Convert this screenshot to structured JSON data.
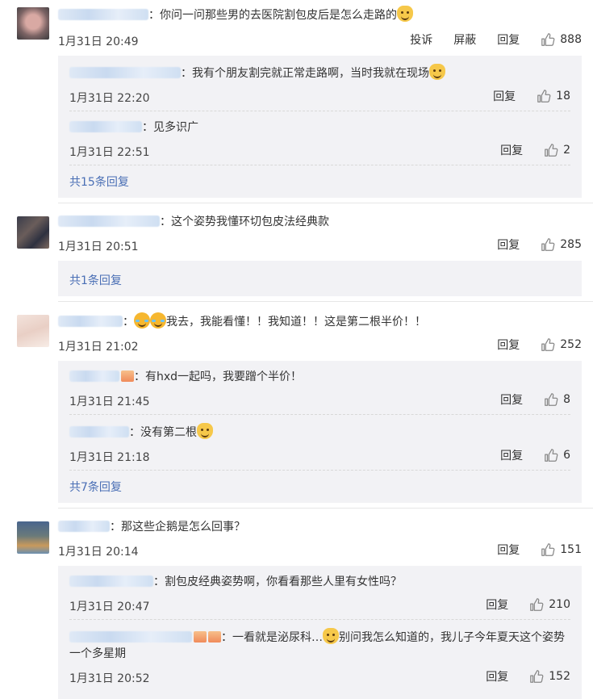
{
  "ui": {
    "time_color": "#444444",
    "link_color": "#4a6fb5",
    "reply_bg": "#f2f2f5"
  },
  "comments": [
    {
      "text": "：你问一问那些男的去医院割包皮后是怎么走路的",
      "time": "1月31日 20:49",
      "report_label": "投诉",
      "block_label": "屏蔽",
      "reply_label": "回复",
      "likes": "888",
      "replies": [
        {
          "text": "：我有个朋友割完就正常走路啊，当时我就在现场",
          "time": "1月31日 22:20",
          "reply_label": "回复",
          "likes": "18"
        },
        {
          "text": "：见多识广",
          "time": "1月31日 22:51",
          "reply_label": "回复",
          "likes": "2"
        }
      ],
      "more_label": "共15条回复"
    },
    {
      "text": "：这个姿势我懂环切包皮法经典款",
      "time": "1月31日 20:51",
      "reply_label": "回复",
      "likes": "285",
      "more_label": "共1条回复"
    },
    {
      "text": "：",
      "text_after": "我去，我能看懂！！我知道！！这是第二根半价！！",
      "time": "1月31日 21:02",
      "reply_label": "回复",
      "likes": "252",
      "replies": [
        {
          "text": "：有hxd一起吗，我要蹭个半价！",
          "time": "1月31日 21:45",
          "reply_label": "回复",
          "likes": "8"
        },
        {
          "text": "：没有第二根",
          "time": "1月31日 21:18",
          "reply_label": "回复",
          "likes": "6"
        }
      ],
      "more_label": "共7条回复"
    },
    {
      "text": "：那这些企鹅是怎么回事？",
      "time": "1月31日 20:14",
      "reply_label": "回复",
      "likes": "151",
      "replies": [
        {
          "text": "：割包皮经典姿势啊，你看看那些人里有女性吗？",
          "time": "1月31日 20:47",
          "reply_label": "回复",
          "likes": "210"
        },
        {
          "text": "：一看就是泌尿科…",
          "text_after": "别问我怎么知道的，我儿子今年夏天这个姿势一个多星期",
          "time": "1月31日 20:52",
          "reply_label": "回复",
          "likes": "152"
        }
      ]
    }
  ]
}
